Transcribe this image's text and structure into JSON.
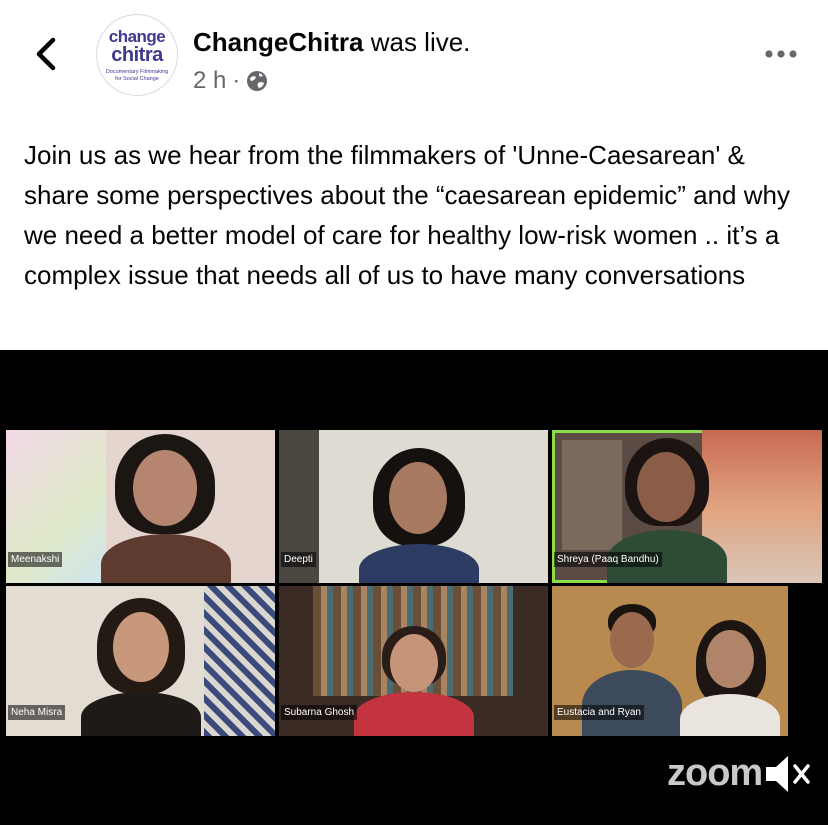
{
  "header": {
    "page_name": "ChangeChitra",
    "status_text": "was live.",
    "time_ago": "2 h",
    "avatar": {
      "line1": "change",
      "line2": "chitra",
      "line3": "Documentary Filmmaking",
      "line4": "for Social Change"
    },
    "icons": {
      "back": "chevron-left-icon",
      "audience": "globe-icon",
      "more": "more-dots-icon"
    }
  },
  "post": {
    "text": "Join us as we hear from the filmmakers of 'Unne-Caesarean' & share some perspectives about the “caesarean epidemic” and why we need a better model of care for healthy low-risk women .. it’s a complex issue that needs all of us to have many conversations"
  },
  "video": {
    "participants": [
      {
        "name": "Meenakshi"
      },
      {
        "name": "Deepti"
      },
      {
        "name": "Shreya (Paaq Bandhu)"
      },
      {
        "name": "Neha Misra"
      },
      {
        "name": "Subarna Ghosh"
      },
      {
        "name": "Eustacia and Ryan"
      }
    ],
    "active_speaker_index": 2,
    "brand": "zoom",
    "colors": {
      "background": "#000000",
      "active_speaker_border": "#8bdc4b"
    }
  }
}
